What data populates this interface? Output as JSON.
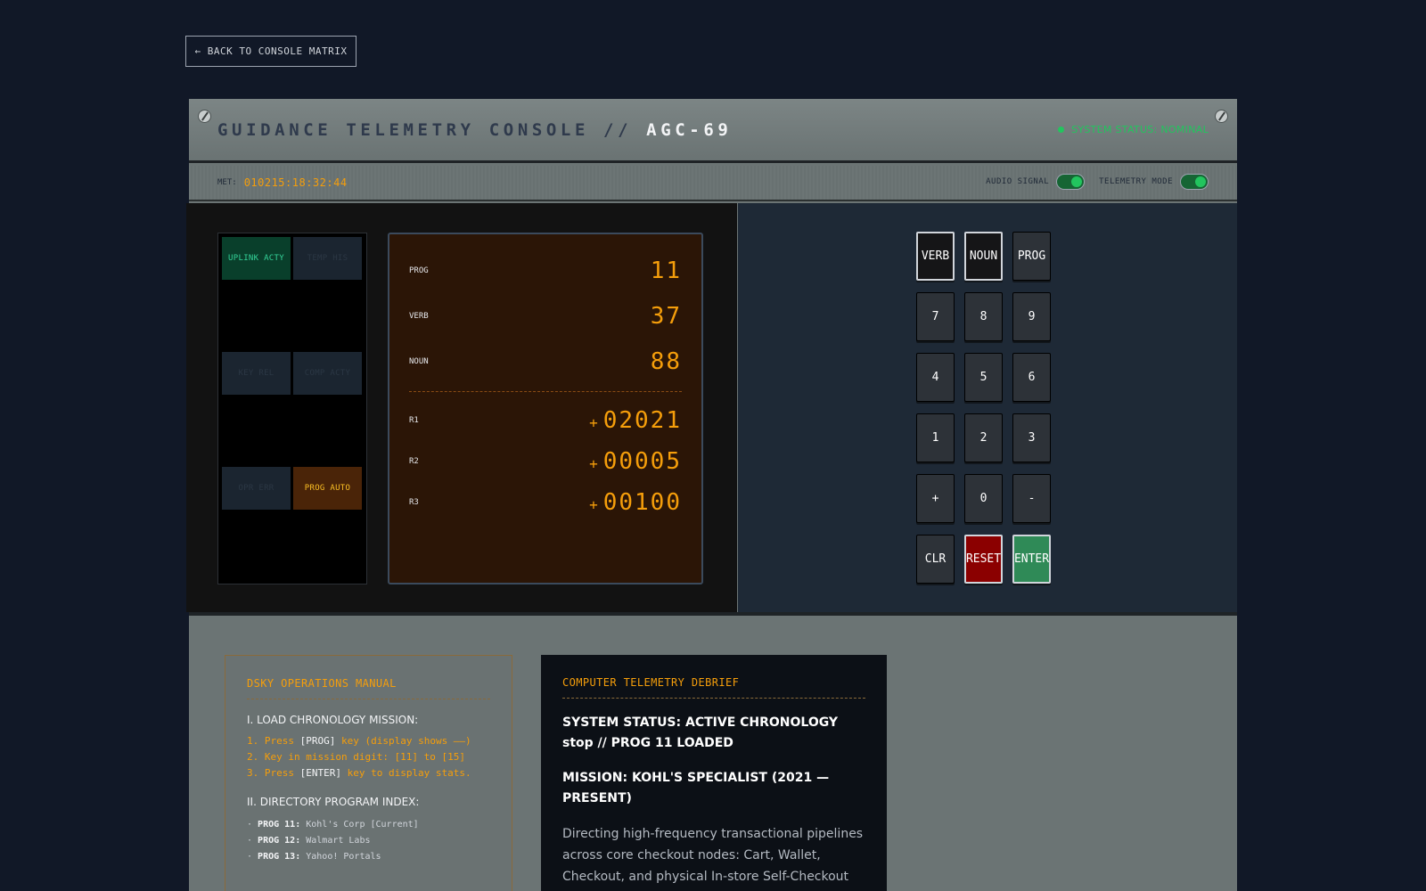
{
  "nav": {
    "back_label": "← BACK TO CONSOLE MATRIX"
  },
  "header": {
    "title_prefix": "GUIDANCE TELEMETRY CONSOLE // ",
    "title_model": "AGC-69",
    "system_status": "SYSTEM STATUS: NOMINAL"
  },
  "status_bar": {
    "met_label": "MET:",
    "met_value": "010215:18:32:44",
    "audio_label": "AUDIO SIGNAL",
    "telemetry_label": "TELEMETRY MODE"
  },
  "lamps": [
    {
      "label": "UPLINK ACTY",
      "state": "green"
    },
    {
      "label": "TEMP HIS",
      "state": "off"
    },
    {
      "label": "KEY REL",
      "state": "off"
    },
    {
      "label": "COMP ACTY",
      "state": "off"
    },
    {
      "label": "OPR ERR",
      "state": "off"
    },
    {
      "label": "PROG AUTO",
      "state": "amber"
    }
  ],
  "display": {
    "prog_label": "PROG",
    "prog_value": "11",
    "verb_label": "VERB",
    "verb_value": "37",
    "noun_label": "NOUN",
    "noun_value": "88",
    "r1_label": "R1",
    "r1_sign": "+",
    "r1_value": "02021",
    "r2_label": "R2",
    "r2_sign": "+",
    "r2_value": "00005",
    "r3_label": "R3",
    "r3_sign": "+",
    "r3_value": "00100"
  },
  "keypad": {
    "verb": "VERB",
    "noun": "NOUN",
    "prog": "PROG",
    "k7": "7",
    "k8": "8",
    "k9": "9",
    "k4": "4",
    "k5": "5",
    "k6": "6",
    "k1": "1",
    "k2": "2",
    "k3": "3",
    "plus": "+",
    "k0": "0",
    "minus": "-",
    "clr": "CLR",
    "reset": "RESET",
    "enter": "ENTER"
  },
  "manual": {
    "title": "DSKY OPERATIONS MANUAL",
    "sec1": "I. LOAD CHRONOLOGY MISSION:",
    "s1a": "1. Press ",
    "s1k": "[PROG]",
    "s1b": " key (display shows ——)",
    "s2": "2. Key in mission digit: [11] to [15]",
    "s3a": "3. Press ",
    "s3k": "[ENTER]",
    "s3b": " key to display stats.",
    "sec2": "II. DIRECTORY PROGRAM INDEX:",
    "idx": [
      {
        "prog": "PROG 11:",
        "desc": "Kohl's Corp [Current]"
      },
      {
        "prog": "PROG 12:",
        "desc": "Walmart Labs"
      },
      {
        "prog": "PROG 13:",
        "desc": "Yahoo! Portals"
      }
    ]
  },
  "debrief": {
    "title": "COMPUTER TELEMETRY DEBRIEF",
    "h1": "SYSTEM STATUS: ACTIVE CHRONOLOGY stop // PROG 11 LOADED",
    "h2": "MISSION: KOHL'S SPECIALIST (2021 — PRESENT)",
    "p": "Directing high-frequency transactional pipelines across core checkout nodes: Cart, Wallet, Checkout, and physical In-store Self-Checkout"
  }
}
